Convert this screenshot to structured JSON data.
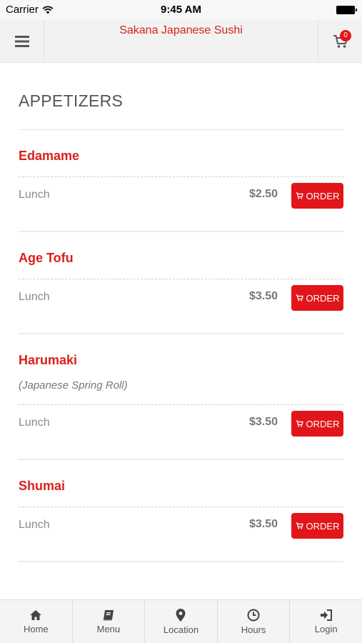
{
  "status_bar": {
    "carrier": "Carrier",
    "time": "9:45 AM"
  },
  "header": {
    "title": "Sakana Japanese Sushi",
    "cart_count": "0"
  },
  "menu": {
    "section_title": "APPETIZERS",
    "items": [
      {
        "name": "Edamame",
        "description": "",
        "size": "Lunch",
        "price": "$2.50",
        "order_label": "ORDER"
      },
      {
        "name": "Age Tofu",
        "description": "",
        "size": "Lunch",
        "price": "$3.50",
        "order_label": "ORDER"
      },
      {
        "name": "Harumaki",
        "description": "(Japanese Spring Roll)",
        "size": "Lunch",
        "price": "$3.50",
        "order_label": "ORDER"
      },
      {
        "name": "Shumai",
        "description": "",
        "size": "Lunch",
        "price": "$3.50",
        "order_label": "ORDER"
      }
    ]
  },
  "tabs": [
    {
      "label": "Home",
      "icon": "home-icon"
    },
    {
      "label": "Menu",
      "icon": "book-icon"
    },
    {
      "label": "Location",
      "icon": "map-marker-icon"
    },
    {
      "label": "Hours",
      "icon": "clock-icon"
    },
    {
      "label": "Login",
      "icon": "sign-in-icon"
    }
  ],
  "colors": {
    "accent": "#e1151a",
    "title_red": "#d9201c",
    "header_bg": "#f2f2f2"
  }
}
